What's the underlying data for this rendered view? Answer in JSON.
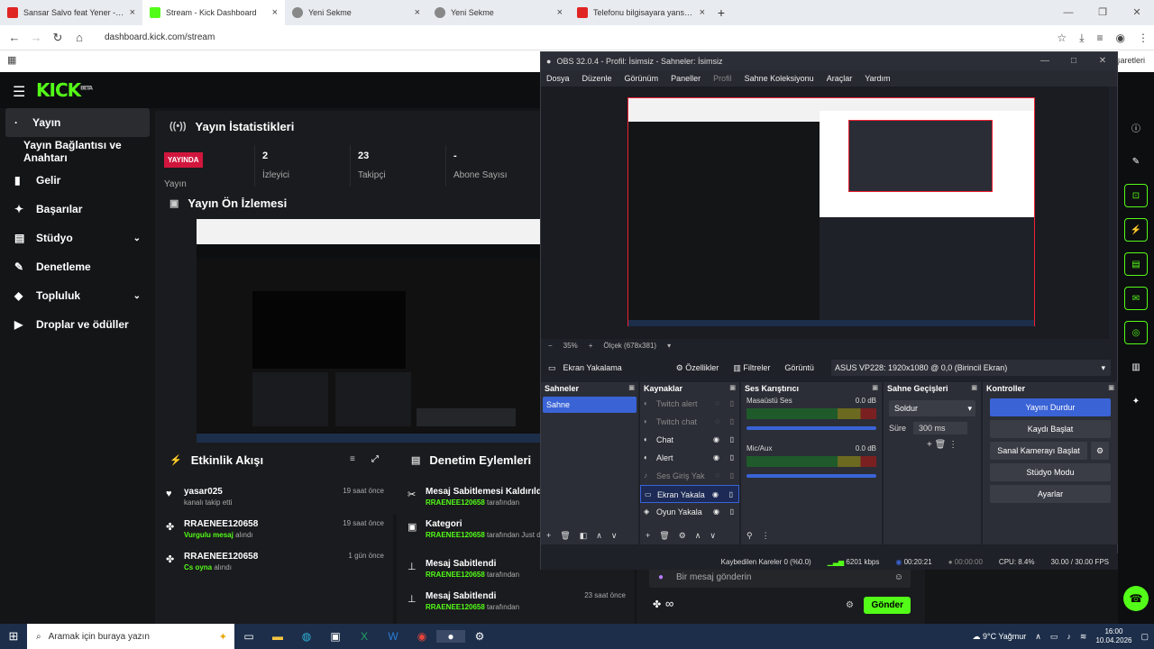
{
  "browser": {
    "tabs": [
      {
        "title": "Sansar Salvo feat Yener - Gökyü",
        "color": "#e02525"
      },
      {
        "title": "Stream - Kick Dashboard",
        "color": "#53fc18"
      },
      {
        "title": "Yeni Sekme",
        "color": "#888888"
      },
      {
        "title": "Yeni Sekme",
        "color": "#888888"
      },
      {
        "title": "Telefonu bilgisayara yansıtma -",
        "color": "#e02525"
      }
    ],
    "url": "dashboard.kick.com/stream",
    "bookmark_right": "şaretleri"
  },
  "kick": {
    "logo": "KICK",
    "logo_sup": "BETA",
    "sidebar": [
      {
        "label": "Yayın",
        "icon": "·"
      },
      {
        "label": "Yayın Bağlantısı ve Anahtarı",
        "icon": ""
      },
      {
        "label": "Gelir",
        "icon": "▮"
      },
      {
        "label": "Başarılar",
        "icon": "✦"
      },
      {
        "label": "Stüdyo",
        "icon": "▤"
      },
      {
        "label": "Denetleme",
        "icon": "✎"
      },
      {
        "label": "Topluluk",
        "icon": "◆"
      },
      {
        "label": "Droplar ve ödüller",
        "icon": "▶"
      }
    ],
    "stats": {
      "title": "Yayın İstatistikleri",
      "live": "YAYINDA",
      "live_label": "Yayın",
      "viewers_value": "2",
      "viewers_label": "İzleyici",
      "followers_value": "23",
      "followers_label": "Takipçi",
      "subs_value": "-",
      "subs_label": "Abone Sayısı"
    },
    "preview_title": "Yayın Ön İzlemesi",
    "feed": {
      "title": "Etkinlik Akışı",
      "items": [
        {
          "name": "yasar025",
          "sub": "kanalı takip etti",
          "green": "",
          "time": "19 saat önce"
        },
        {
          "name": "RRAENEE120658",
          "sub": "alındı",
          "green": "Vurgulu mesaj",
          "time": "19 saat önce"
        },
        {
          "name": "RRAENEE120658",
          "sub": "alındı",
          "green": "Cs oyna",
          "time": "1 gün önce"
        }
      ]
    },
    "mod": {
      "title": "Denetim Eylemleri",
      "items": [
        {
          "name": "Mesaj Sabitlemesi Kaldırıldı",
          "green": "RRAENEE120658",
          "sub": "tarafından",
          "time": ""
        },
        {
          "name": "Kategori",
          "green": "RRAENEE120658",
          "sub": "tarafından Just değiştirildi",
          "time": ""
        },
        {
          "name": "Mesaj Sabitlendi",
          "green": "RRAENEE120658",
          "sub": "tarafından",
          "time": ""
        },
        {
          "name": "Mesaj Sabitlendi",
          "green": "RRAENEE120658",
          "sub": "tarafından",
          "time": "23 saat önce"
        }
      ]
    },
    "chat": {
      "placeholder": "Bir mesaj gönderin",
      "send": "Gönder",
      "infinity": "∞"
    }
  },
  "obs": {
    "title": "OBS 32.0.4 - Profil: İsimsiz - Sahneler: İsimsiz",
    "menu": [
      "Dosya",
      "Düzenle",
      "Görünüm",
      "Paneller",
      "Profil",
      "Sahne Koleksiyonu",
      "Araçlar",
      "Yardım"
    ],
    "zoom": "35%",
    "scale": "Ölçek (678x381)",
    "source_name": "Ekran Yakalama",
    "props": "Özellikler",
    "filters": "Filtreler",
    "display_label": "Görüntü",
    "display_value": "ASUS VP228: 1920x1080 @ 0,0 (Birincil Ekran)",
    "scenes_title": "Sahneler",
    "scene": "Sahne",
    "sources_title": "Kaynaklar",
    "sources": [
      {
        "name": "Twitch alert",
        "dim": true
      },
      {
        "name": "Twitch chat",
        "dim": true
      },
      {
        "name": "Chat",
        "dim": false
      },
      {
        "name": "Alert",
        "dim": false
      },
      {
        "name": "Ses Giriş Yak",
        "dim": true
      },
      {
        "name": "Ekran Yakala",
        "dim": false,
        "selected": true
      },
      {
        "name": "Oyun Yakala",
        "dim": false
      }
    ],
    "mixer_title": "Ses Karıştırıcı",
    "mixer": [
      {
        "name": "Masaüstü Ses",
        "db": "0.0 dB"
      },
      {
        "name": "Mic/Aux",
        "db": "0.0 dB"
      }
    ],
    "transitions_title": "Sahne Geçişleri",
    "transition": "Soldur",
    "duration_label": "Süre",
    "duration": "300 ms",
    "controls_title": "Kontroller",
    "controls": [
      "Yayını Durdur",
      "Kaydı Başlat",
      "Sanal Kamerayı Başlat",
      "Stüdyo Modu",
      "Ayarlar"
    ],
    "status": {
      "dropped": "Kaybedilen Kareler 0 (%0.0)",
      "bitrate": "6201 kbps",
      "stream_time": "00:20:21",
      "rec_time": "00:00:00",
      "cpu": "CPU: 8.4%",
      "fps": "30.00 / 30.00 FPS"
    }
  },
  "taskbar": {
    "search": "Aramak için buraya yazın",
    "weather": "9°C  Yağmur",
    "time": "16:00",
    "date": "10.04.2026"
  }
}
